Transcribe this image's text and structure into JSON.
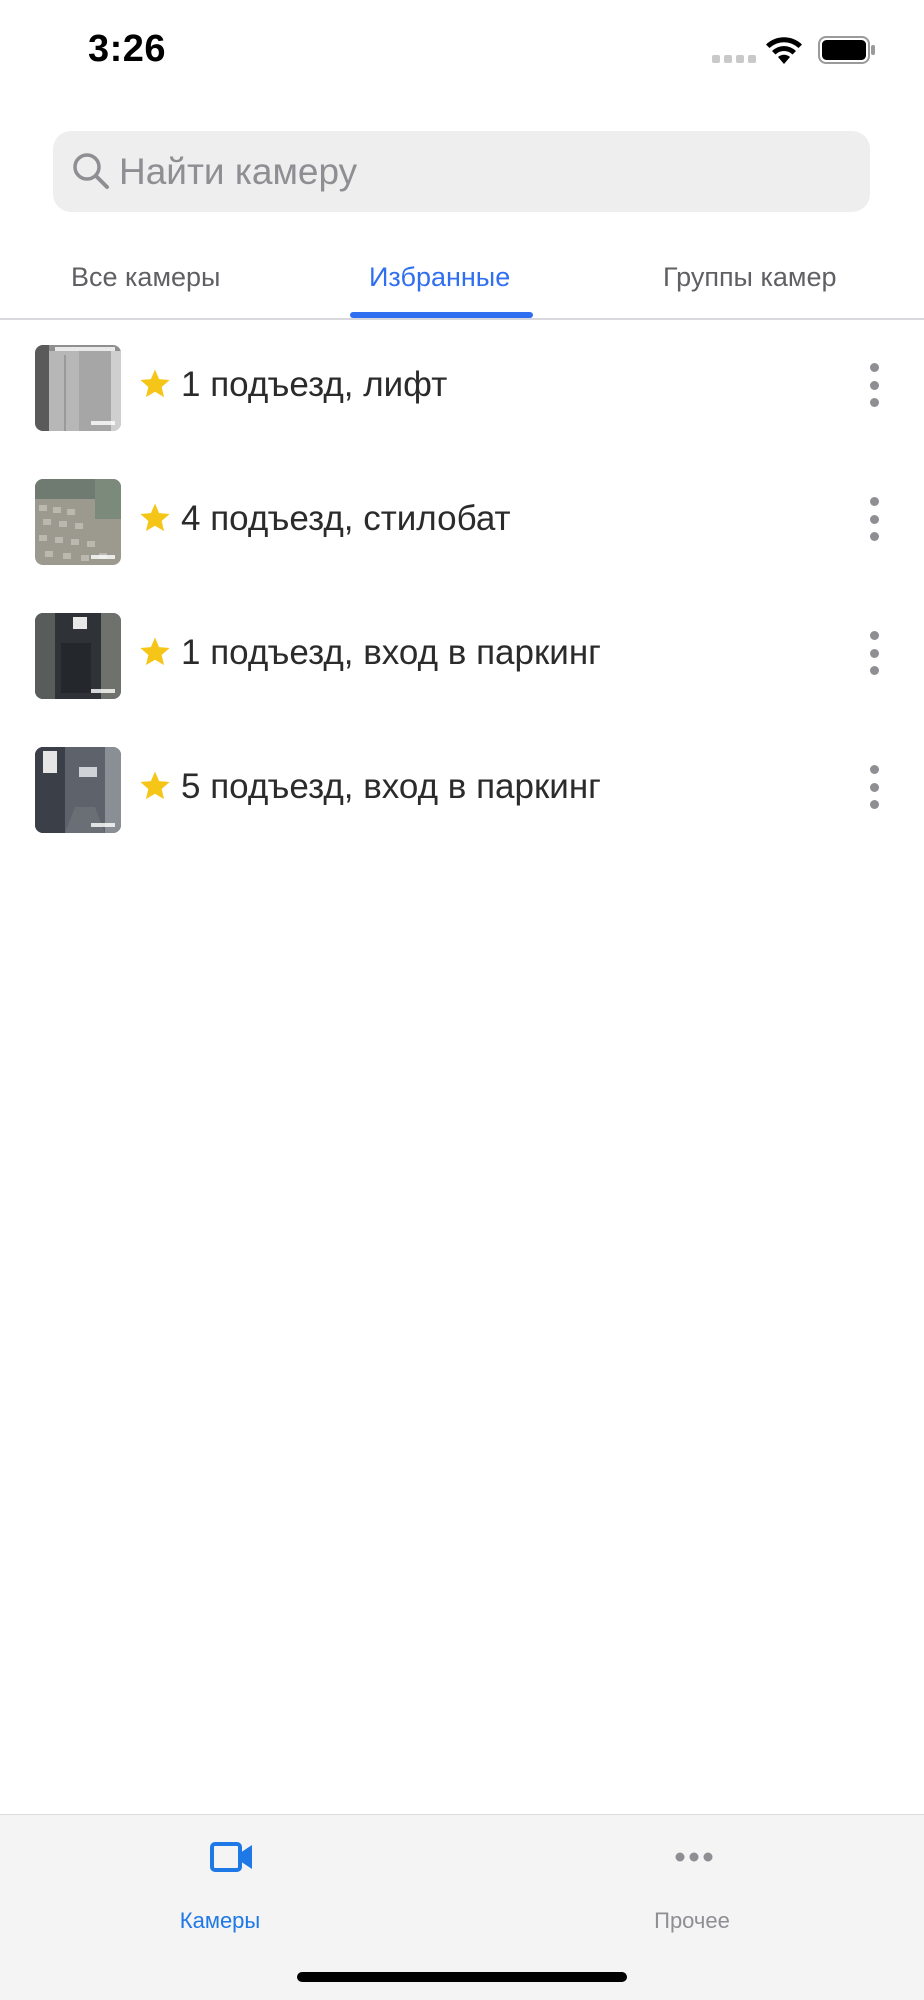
{
  "status_bar": {
    "time": "3:26"
  },
  "search": {
    "placeholder": "Найти камеру"
  },
  "tabs": [
    {
      "label": "Все камеры",
      "active": false
    },
    {
      "label": "Избранные",
      "active": true
    },
    {
      "label": "Группы камер",
      "active": false
    }
  ],
  "cameras": [
    {
      "name": "1 подъезд, лифт",
      "favorite": true,
      "thumbnail": "elevator-hall"
    },
    {
      "name": "4 подъезд, стилобат",
      "favorite": true,
      "thumbnail": "paved-courtyard"
    },
    {
      "name": "1 подъезд, вход в паркинг",
      "favorite": true,
      "thumbnail": "parking-entrance-door"
    },
    {
      "name": "5 подъезд, вход в паркинг",
      "favorite": true,
      "thumbnail": "parking-entrance-corridor"
    }
  ],
  "bottom_nav": {
    "cameras_label": "Камеры",
    "other_label": "Прочее"
  },
  "colors": {
    "accent": "#2f6ff0",
    "nav_active": "#1e78e6",
    "star": "#f5c518",
    "inactive": "#8e8e93"
  },
  "icons": {
    "search": "search-icon",
    "favorite": "star-icon",
    "row_menu": "more-vertical-icon",
    "cameras": "video-camera-icon",
    "other": "more-horizontal-icon"
  }
}
